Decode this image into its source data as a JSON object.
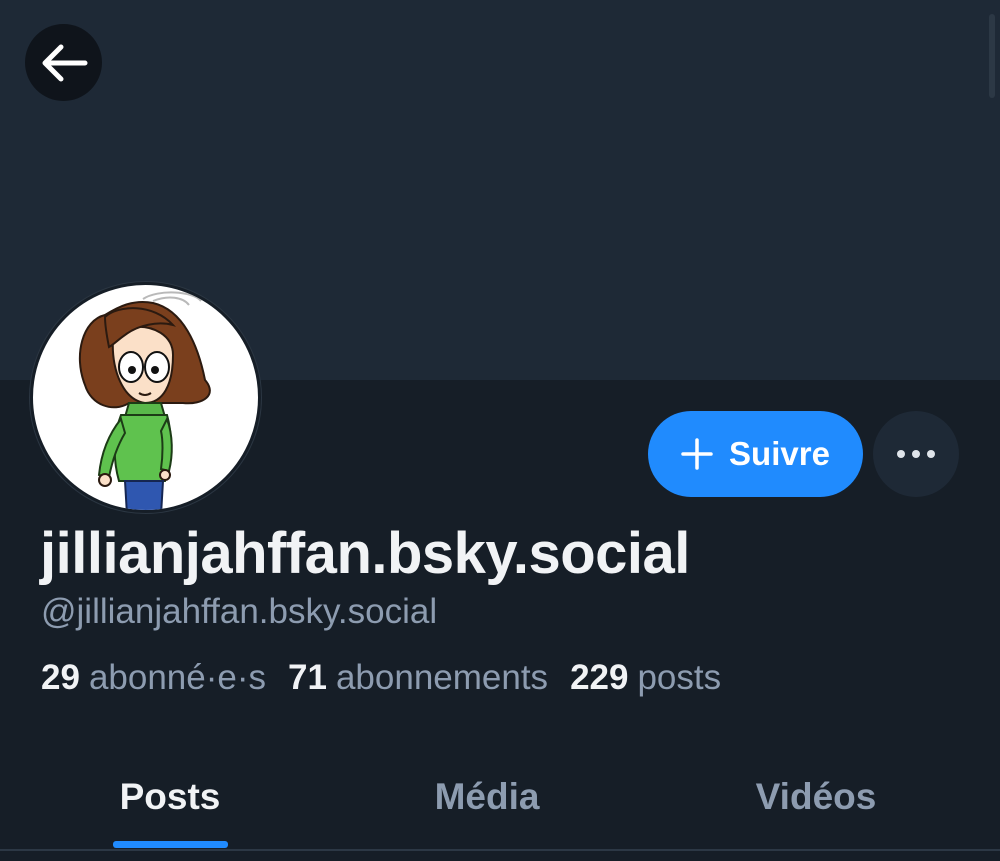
{
  "profile": {
    "display_name": "jillianjahffan.bsky.social",
    "handle": "@jillianjahffan.bsky.social"
  },
  "actions": {
    "follow_label": "Suivre",
    "follow_icon": "plus-icon",
    "more_icon": "ellipsis-icon",
    "back_icon": "arrow-left-icon"
  },
  "stats": [
    {
      "count": "29",
      "label": "abonné·e·s"
    },
    {
      "count": "71",
      "label": "abonnements"
    },
    {
      "count": "229",
      "label": "posts"
    }
  ],
  "tabs": [
    {
      "label": "Posts",
      "active": true
    },
    {
      "label": "Média",
      "active": false
    },
    {
      "label": "Vidéos",
      "active": false
    }
  ],
  "colors": {
    "background": "#161e27",
    "banner": "#1e2936",
    "accent": "#208bfe",
    "text_primary": "#f1f3f5",
    "text_secondary": "#8d9cb0"
  }
}
